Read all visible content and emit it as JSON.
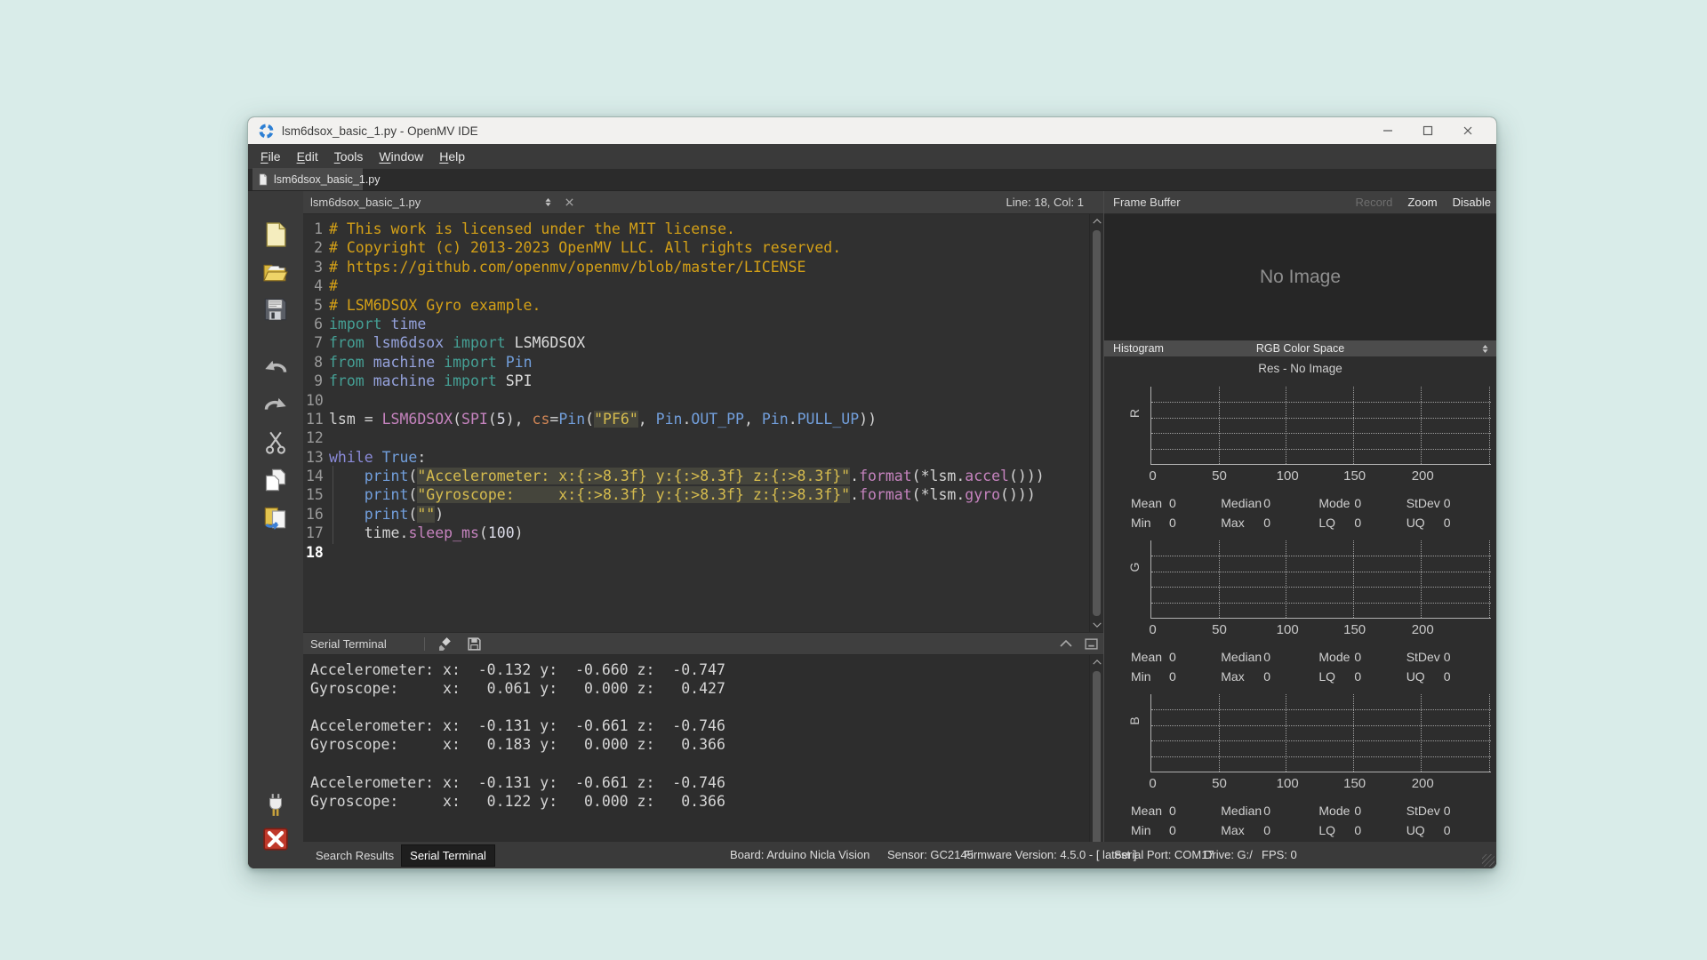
{
  "window": {
    "title": "lsm6dsox_basic_1.py - OpenMV IDE",
    "controls": [
      "minimize",
      "maximize",
      "close"
    ]
  },
  "menu": {
    "items": [
      "File",
      "Edit",
      "Tools",
      "Window",
      "Help"
    ]
  },
  "doc_tab": {
    "label": "lsm6dsox_basic_1.py"
  },
  "editor": {
    "combo_label": "lsm6dsox_basic_1.py",
    "cursor_pos": "Line: 18, Col: 1",
    "current_line": 18,
    "lines": [
      [
        [
          "# This work is licensed under the MIT license.",
          "com"
        ]
      ],
      [
        [
          "# Copyright (c) 2013-2023 OpenMV LLC. All rights reserved.",
          "com"
        ]
      ],
      [
        [
          "# https://github.com/openmv/openmv/blob/master/LICENSE",
          "com"
        ]
      ],
      [
        [
          "#",
          "com"
        ]
      ],
      [
        [
          "# LSM6DSOX Gyro example.",
          "com"
        ]
      ],
      [
        [
          "import",
          "kwt"
        ],
        [
          " ",
          "pln"
        ],
        [
          "time",
          "mod"
        ]
      ],
      [
        [
          "from",
          "kwt"
        ],
        [
          " ",
          "pln"
        ],
        [
          "lsm6dsox",
          "mod"
        ],
        [
          " ",
          "pln"
        ],
        [
          "import",
          "kwt"
        ],
        [
          " ",
          "pln"
        ],
        [
          "LSM6DSOX",
          "cls"
        ]
      ],
      [
        [
          "from",
          "kwt"
        ],
        [
          " ",
          "pln"
        ],
        [
          "machine",
          "mod"
        ],
        [
          " ",
          "pln"
        ],
        [
          "import",
          "kwt"
        ],
        [
          " ",
          "pln"
        ],
        [
          "Pin",
          "typ"
        ]
      ],
      [
        [
          "from",
          "kwt"
        ],
        [
          " ",
          "pln"
        ],
        [
          "machine",
          "mod"
        ],
        [
          " ",
          "pln"
        ],
        [
          "import",
          "kwt"
        ],
        [
          " ",
          "pln"
        ],
        [
          "SPI",
          "cls"
        ]
      ],
      [],
      [
        [
          "lsm = ",
          "pln"
        ],
        [
          "LSM6DSOX",
          "fn"
        ],
        [
          "(",
          "pln"
        ],
        [
          "SPI",
          "fn"
        ],
        [
          "(",
          "pln"
        ],
        [
          "5",
          "num"
        ],
        [
          "), ",
          "pln"
        ],
        [
          "cs",
          "par"
        ],
        [
          "=",
          "pln"
        ],
        [
          "Pin",
          "typ"
        ],
        [
          "(",
          "pln"
        ],
        [
          "\"PF6\"",
          "str"
        ],
        [
          ", ",
          "pln"
        ],
        [
          "Pin",
          "typ"
        ],
        [
          ".",
          "pln"
        ],
        [
          "OUT_PP",
          "typ"
        ],
        [
          ", ",
          "pln"
        ],
        [
          "Pin",
          "typ"
        ],
        [
          ".",
          "pln"
        ],
        [
          "PULL_UP",
          "typ"
        ],
        [
          "))",
          "pln"
        ]
      ],
      [],
      [
        [
          "while",
          "kww"
        ],
        [
          " ",
          "pln"
        ],
        [
          "True",
          "typ"
        ],
        [
          ":",
          "pln"
        ]
      ],
      [
        [
          "    ",
          "pln"
        ],
        [
          "print",
          "typ"
        ],
        [
          "(",
          "pln"
        ],
        [
          "\"Accelerometer: x:{:>8.3f} y:{:>8.3f} z:{:>8.3f}\"",
          "str"
        ],
        [
          ".",
          "pln"
        ],
        [
          "format",
          "fn"
        ],
        [
          "(*lsm.",
          "pln"
        ],
        [
          "accel",
          "fn"
        ],
        [
          "()))",
          "pln"
        ]
      ],
      [
        [
          "    ",
          "pln"
        ],
        [
          "print",
          "typ"
        ],
        [
          "(",
          "pln"
        ],
        [
          "\"Gyroscope:     x:{:>8.3f} y:{:>8.3f} z:{:>8.3f}\"",
          "str"
        ],
        [
          ".",
          "pln"
        ],
        [
          "format",
          "fn"
        ],
        [
          "(*lsm.",
          "pln"
        ],
        [
          "gyro",
          "fn"
        ],
        [
          "()))",
          "pln"
        ]
      ],
      [
        [
          "    ",
          "pln"
        ],
        [
          "print",
          "typ"
        ],
        [
          "(",
          "pln"
        ],
        [
          "\"\"",
          "str"
        ],
        [
          ")",
          "pln"
        ]
      ],
      [
        [
          "    ",
          "pln"
        ],
        [
          "time",
          "pln"
        ],
        [
          ".",
          "pln"
        ],
        [
          "sleep_ms",
          "fn"
        ],
        [
          "(",
          "pln"
        ],
        [
          "100",
          "num"
        ],
        [
          ")",
          "pln"
        ]
      ],
      []
    ]
  },
  "terminal": {
    "title": "Serial Terminal",
    "icons": [
      "clear-terminal",
      "save-log"
    ],
    "lines": [
      "Accelerometer: x:  -0.132 y:  -0.660 z:  -0.747",
      "Gyroscope:     x:   0.061 y:   0.000 z:   0.427",
      "",
      "Accelerometer: x:  -0.131 y:  -0.661 z:  -0.746",
      "Gyroscope:     x:   0.183 y:   0.000 z:   0.366",
      "",
      "Accelerometer: x:  -0.131 y:  -0.661 z:  -0.746",
      "Gyroscope:     x:   0.122 y:   0.000 z:   0.366"
    ]
  },
  "frame_buffer": {
    "title": "Frame Buffer",
    "record": "Record",
    "record_enabled": false,
    "zoom": "Zoom",
    "disable": "Disable",
    "no_image": "No Image"
  },
  "histogram": {
    "title": "Histogram",
    "color_space": "RGB Color Space",
    "res": "Res - No Image",
    "ticks": [
      "0",
      "50",
      "100",
      "150",
      "200"
    ],
    "channels": [
      {
        "label": "R",
        "stats": [
          [
            "Mean",
            "0"
          ],
          [
            "Median",
            "0"
          ],
          [
            "Mode",
            "0"
          ],
          [
            "StDev",
            "0"
          ],
          [
            "Min",
            "0"
          ],
          [
            "Max",
            "0"
          ],
          [
            "LQ",
            "0"
          ],
          [
            "UQ",
            "0"
          ]
        ]
      },
      {
        "label": "G",
        "stats": [
          [
            "Mean",
            "0"
          ],
          [
            "Median",
            "0"
          ],
          [
            "Mode",
            "0"
          ],
          [
            "StDev",
            "0"
          ],
          [
            "Min",
            "0"
          ],
          [
            "Max",
            "0"
          ],
          [
            "LQ",
            "0"
          ],
          [
            "UQ",
            "0"
          ]
        ]
      },
      {
        "label": "B",
        "stats": [
          [
            "Mean",
            "0"
          ],
          [
            "Median",
            "0"
          ],
          [
            "Mode",
            "0"
          ],
          [
            "StDev",
            "0"
          ],
          [
            "Min",
            "0"
          ],
          [
            "Max",
            "0"
          ],
          [
            "LQ",
            "0"
          ],
          [
            "UQ",
            "0"
          ]
        ]
      }
    ]
  },
  "sidebar": {
    "icons": [
      "new-file",
      "open-file",
      "save-file",
      "undo",
      "redo",
      "cut",
      "copy",
      "paste"
    ],
    "bottom_icons": [
      "connect",
      "disconnect"
    ]
  },
  "status_bar": {
    "tabs": [
      {
        "label": "Search Results",
        "active": false
      },
      {
        "label": "Serial Terminal",
        "active": true
      }
    ],
    "items": [
      "Board: Arduino Nicla Vision",
      "Sensor: GC2145",
      "Firmware Version: 4.5.0 - [ latest ]",
      "Serial Port: COM17",
      "Drive: G:/",
      "FPS: 0"
    ]
  },
  "colors": {
    "desktop_bg": "#d9ece9",
    "titlebar_bg": "#f2f1ef",
    "chrome_bg": "#3a3a3a",
    "editor_bg": "#303030",
    "accent_logo": "#2C7FD4",
    "comment": "#D4A017",
    "string": "#D6BC4E",
    "disconnect_red": "#C0392B"
  }
}
